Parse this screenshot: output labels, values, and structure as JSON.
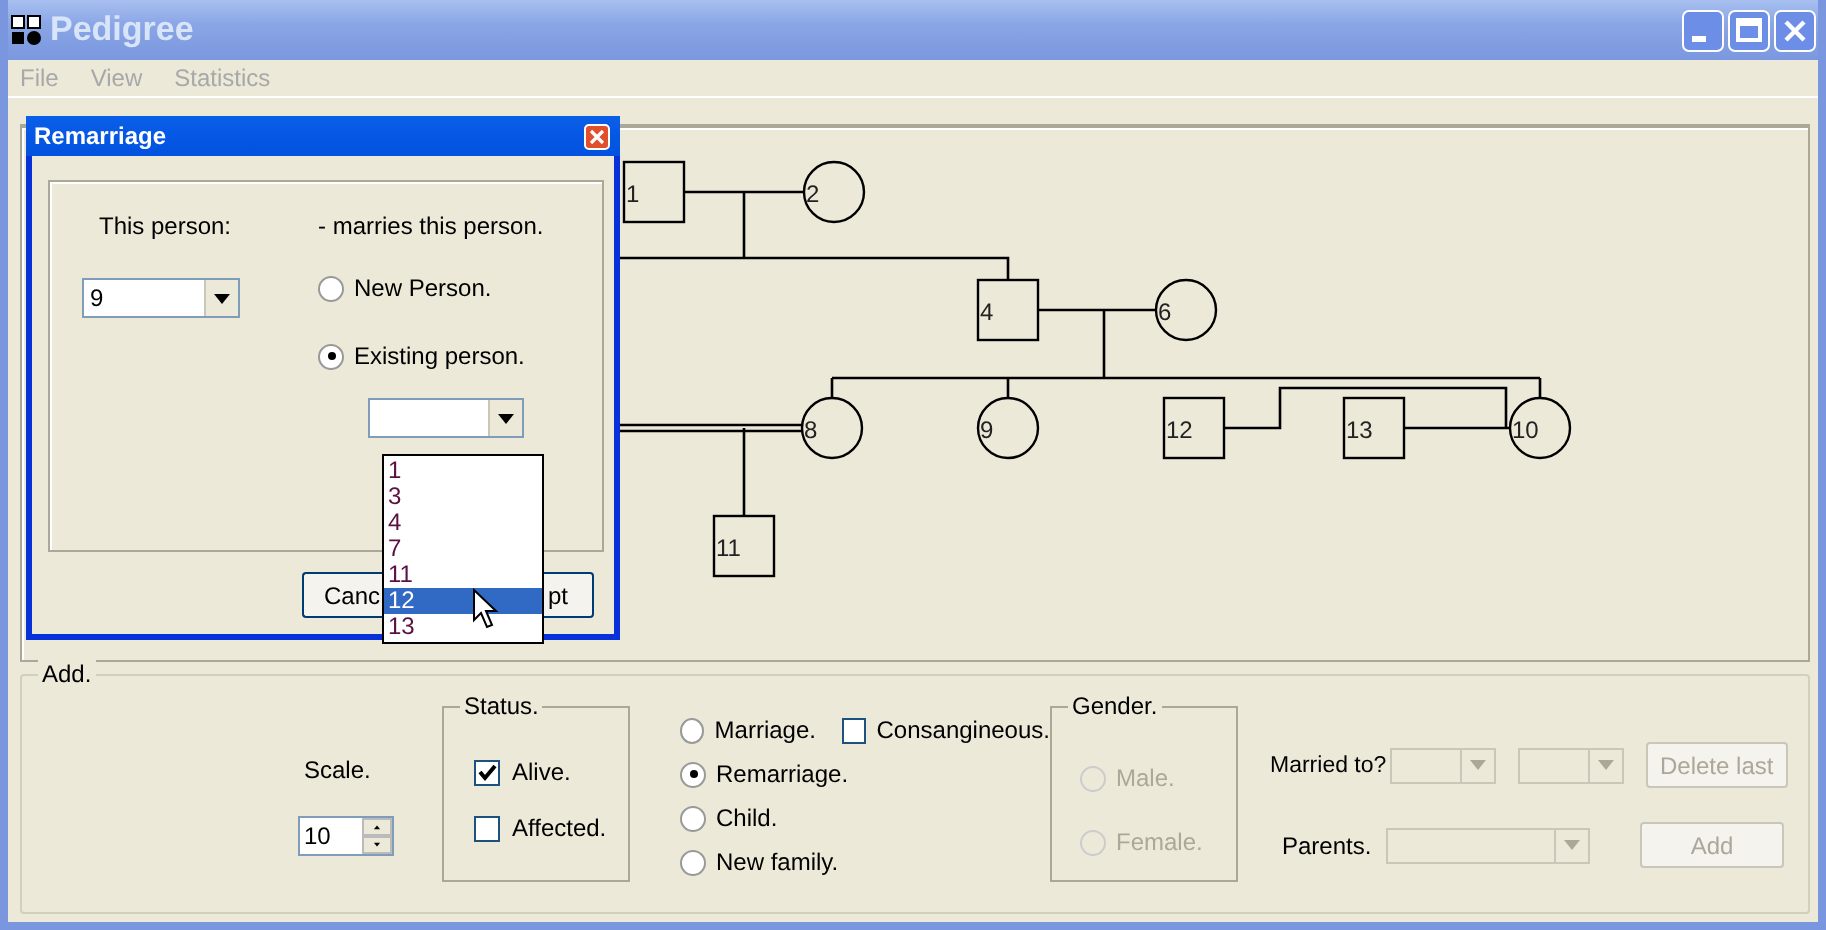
{
  "window": {
    "title": "Pedigree"
  },
  "menu": [
    "File",
    "View",
    "Statistics"
  ],
  "pedigree": {
    "individuals": [
      {
        "label": "1",
        "kind": "male"
      },
      {
        "label": "2",
        "kind": "female"
      },
      {
        "label": "4",
        "kind": "male"
      },
      {
        "label": "6",
        "kind": "female"
      },
      {
        "label": "8",
        "kind": "female"
      },
      {
        "label": "9",
        "kind": "female"
      },
      {
        "label": "12",
        "kind": "male"
      },
      {
        "label": "13",
        "kind": "male"
      },
      {
        "label": "10",
        "kind": "female"
      },
      {
        "label": "11",
        "kind": "male"
      }
    ]
  },
  "dialog": {
    "title": "Remarriage",
    "this_person_label": "This person:",
    "this_person_value": "9",
    "marries_label": "- marries this person.",
    "options": [
      {
        "label": "New Person.",
        "selected": false
      },
      {
        "label": "Existing person.",
        "selected": true
      }
    ],
    "person_dropdown": {
      "expanded": true,
      "items": [
        {
          "label": "1",
          "selected": false
        },
        {
          "label": "3",
          "selected": false
        },
        {
          "label": "4",
          "selected": false
        },
        {
          "label": "7",
          "selected": false
        },
        {
          "label": "11",
          "selected": false
        },
        {
          "label": "12",
          "selected": true
        },
        {
          "label": "13",
          "selected": false
        }
      ]
    },
    "buttons": [
      "Canc",
      "pt"
    ]
  },
  "add": {
    "title": "Add.",
    "scale_label": "Scale.",
    "scale_value": "10",
    "status": {
      "title": "Status.",
      "checks": [
        {
          "label": "Alive.",
          "checked": true
        },
        {
          "label": "Affected.",
          "checked": false
        }
      ]
    },
    "relation": [
      {
        "label": "Marriage.",
        "selected": false
      },
      {
        "label": "Remarriage.",
        "selected": true
      },
      {
        "label": "Child.",
        "selected": false
      },
      {
        "label": "New family.",
        "selected": false
      }
    ],
    "consanguineous": {
      "label": "Consangineous.",
      "checked": false
    },
    "gender": {
      "title": "Gender.",
      "disabled": true,
      "options": [
        {
          "label": "Male.",
          "selected": false
        },
        {
          "label": "Female.",
          "selected": false
        }
      ]
    },
    "married_to_label": "Married to?",
    "married_to_combos": [
      {
        "disabled": true
      },
      {
        "disabled": true
      }
    ],
    "parents_label": "Parents.",
    "parents_combo": {
      "disabled": true
    },
    "buttons": [
      {
        "label": "Delete last",
        "disabled": true
      },
      {
        "label": "Add",
        "disabled": true
      }
    ]
  }
}
